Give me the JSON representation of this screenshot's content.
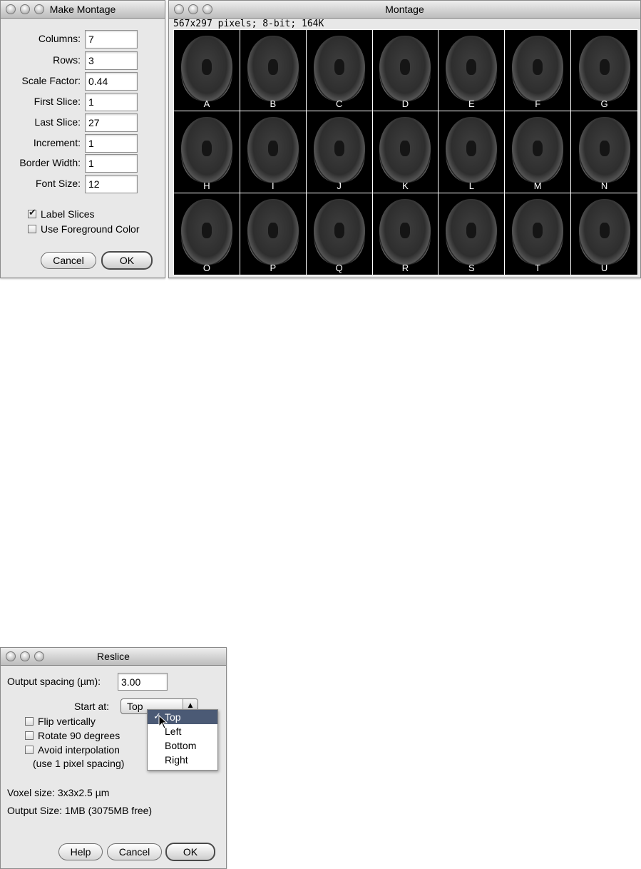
{
  "make_montage": {
    "title": "Make Montage",
    "fields": [
      {
        "label": "Columns:",
        "value": "7"
      },
      {
        "label": "Rows:",
        "value": "3"
      },
      {
        "label": "Scale Factor:",
        "value": "0.44"
      },
      {
        "label": "First Slice:",
        "value": "1"
      },
      {
        "label": "Last Slice:",
        "value": "27"
      },
      {
        "label": "Increment:",
        "value": "1"
      },
      {
        "label": "Border Width:",
        "value": "1"
      },
      {
        "label": "Font Size:",
        "value": "12"
      }
    ],
    "checkboxes": [
      {
        "label": "Label Slices",
        "checked": true
      },
      {
        "label": "Use Foreground Color",
        "checked": false
      }
    ],
    "cancel_label": "Cancel",
    "ok_label": "OK"
  },
  "montage_window": {
    "title": "Montage",
    "info": "567x297 pixels; 8-bit; 164K",
    "slice_labels": [
      "A",
      "B",
      "C",
      "D",
      "E",
      "F",
      "G",
      "H",
      "I",
      "J",
      "K",
      "L",
      "M",
      "N",
      "O",
      "P",
      "Q",
      "R",
      "S",
      "T",
      "U"
    ]
  },
  "reslice": {
    "title": "Reslice",
    "output_spacing_label": "Output spacing (µm):",
    "output_spacing_value": "3.00",
    "start_at_label": "Start at:",
    "start_at_value": "Top",
    "start_at_options": [
      "Top",
      "Left",
      "Bottom",
      "Right"
    ],
    "checkboxes": [
      {
        "label": "Flip vertically",
        "checked": false
      },
      {
        "label": "Rotate 90 degrees",
        "checked": false
      },
      {
        "label": "Avoid interpolation",
        "checked": false
      }
    ],
    "interp_note": "(use 1 pixel spacing)",
    "voxel_size": "Voxel size: 3x3x2.5 µm",
    "output_size": "Output Size: 1MB (3075MB free)",
    "help_label": "Help",
    "cancel_label": "Cancel",
    "ok_label": "OK"
  },
  "icons": {
    "traffic_lights": "window-control-buttons",
    "checkmark": "check-icon",
    "cursor": "arrow-cursor-icon"
  }
}
